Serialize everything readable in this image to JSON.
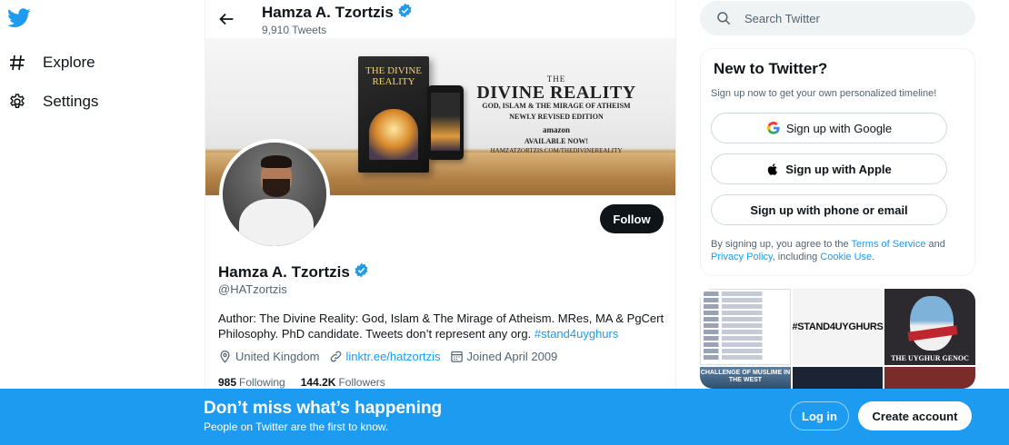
{
  "colors": {
    "brand": "#1d9bf0",
    "text": "#0f1419",
    "muted": "#536471",
    "follow_bg": "#0f1419"
  },
  "nav": {
    "logo_icon": "twitter-bird-icon",
    "items": [
      {
        "icon": "hashtag-icon",
        "label": "Explore"
      },
      {
        "icon": "gear-icon",
        "label": "Settings"
      }
    ]
  },
  "header": {
    "name": "Hamza A. Tzortzis",
    "tweet_count": "9,910 Tweets"
  },
  "banner": {
    "book_title": "THE DIVINE REALITY",
    "line1": "THE",
    "line2": "DIVINE REALITY",
    "line3": "GOD, ISLAM & THE MIRAGE OF ATHEISM",
    "line4": "NEWLY REVISED EDITION",
    "line5": "amazon",
    "line6": "AVAILABLE NOW!",
    "line7": "HAMZATZORTZIS.COM/THEDIVINEREALITY"
  },
  "profile": {
    "follow_label": "Follow",
    "name": "Hamza A. Tzortzis",
    "handle": "@HATzortzis",
    "bio": "Author: The Divine Reality: God, Islam & The Mirage of Atheism. MRes, MA & PgCert Philosophy. PhD candidate. Tweets don’t represent any org.",
    "bio_tag": "#stand4uyghurs",
    "location": "United Kingdom",
    "link": "linktr.ee/hatzortzis",
    "joined": "Joined April 2009",
    "following_count": "985",
    "following_label": "Following",
    "followers_count": "144.2K",
    "followers_label": "Followers"
  },
  "search": {
    "placeholder": "Search Twitter"
  },
  "signup": {
    "title": "New to Twitter?",
    "subtitle": "Sign up now to get your own personalized timeline!",
    "google": "Sign up with Google",
    "apple": "Sign up with Apple",
    "phone": "Sign up with phone or email",
    "terms_prefix": "By signing up, you agree to the",
    "terms_link": "Terms of Service",
    "terms_and": "and",
    "privacy_link": "Privacy Policy",
    "terms_including": ", including",
    "cookie_link": "Cookie Use",
    "terms_end": "."
  },
  "media": {
    "tile2_text": "#STAND4UYGHURS",
    "tile3_text": "THE UYGHUR GENOC",
    "tile4_text": "CHALLENGE OF MUSLIME IN THE WEST"
  },
  "bottom": {
    "title": "Don’t miss what’s happening",
    "subtitle": "People on Twitter are the first to know.",
    "login": "Log in",
    "create": "Create account"
  }
}
